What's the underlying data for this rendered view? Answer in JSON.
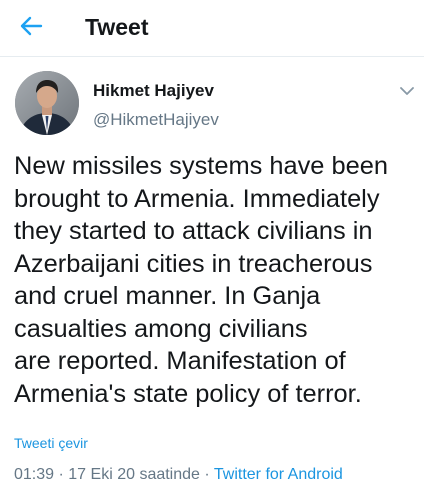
{
  "header": {
    "title": "Tweet",
    "back_icon": "arrow-left-icon"
  },
  "colors": {
    "accent": "#1da1f2",
    "link": "#1b95e0",
    "text": "#14171a",
    "muted": "#657786",
    "divider": "#e6ecf0"
  },
  "tweet": {
    "author_name": "Hikmet Hajiyev",
    "author_handle": "@HikmetHajiyev",
    "menu_icon": "chevron-down-icon",
    "text": "New missiles systems have been\nbrought to Armenia. Immediately\nthey started to attack civilians in\nAzerbaijani cities in treacherous\nand cruel manner. In Ganja\ncasualties among civilians\nare reported. Manifestation of\nArmenia's state policy of terror.",
    "translate_label": "Tweeti çevir",
    "time": "01:39",
    "separator": "·",
    "date": "17 Eki 20 saatinde",
    "source": "Twitter for Android"
  }
}
